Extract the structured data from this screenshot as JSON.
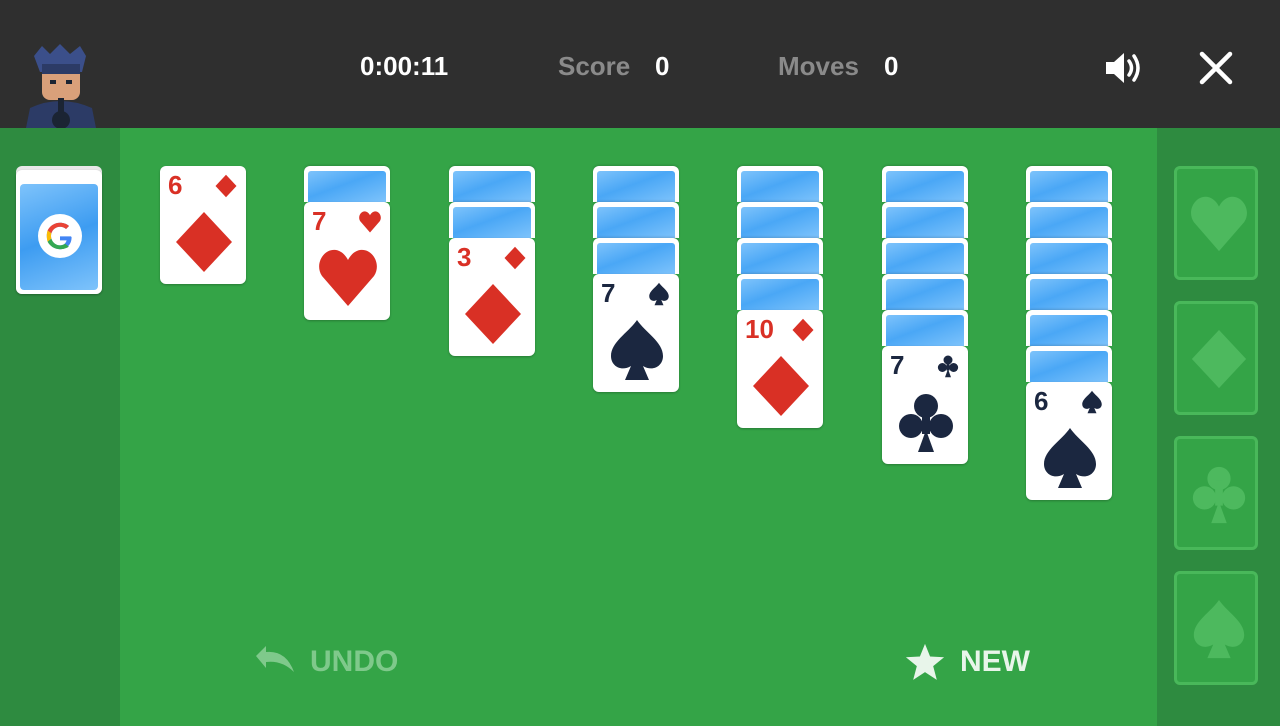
{
  "header": {
    "timer": "0:00:11",
    "score_label": "Score",
    "score_value": "0",
    "moves_label": "Moves",
    "moves_value": "0",
    "sound_icon": "speaker-icon",
    "close_icon": "close-icon"
  },
  "stock": {
    "icon": "google-g-icon"
  },
  "tableau": [
    {
      "face_down": 0,
      "rank": "6",
      "suit": "diamond",
      "color": "red"
    },
    {
      "face_down": 1,
      "rank": "7",
      "suit": "heart",
      "color": "red"
    },
    {
      "face_down": 2,
      "rank": "3",
      "suit": "diamond",
      "color": "red"
    },
    {
      "face_down": 3,
      "rank": "7",
      "suit": "spade",
      "color": "dark"
    },
    {
      "face_down": 4,
      "rank": "10",
      "suit": "diamond",
      "color": "red"
    },
    {
      "face_down": 5,
      "rank": "7",
      "suit": "club",
      "color": "dark"
    },
    {
      "face_down": 6,
      "rank": "6",
      "suit": "spade",
      "color": "dark"
    }
  ],
  "foundations": [
    "heart",
    "diamond",
    "club",
    "spade"
  ],
  "controls": {
    "undo_label": "UNDO",
    "new_label": "NEW"
  },
  "colors": {
    "felt": "#34a447",
    "panel": "#2e8b40",
    "bar": "#2f2f2f",
    "red": "#d93025",
    "dark": "#1b2740"
  }
}
